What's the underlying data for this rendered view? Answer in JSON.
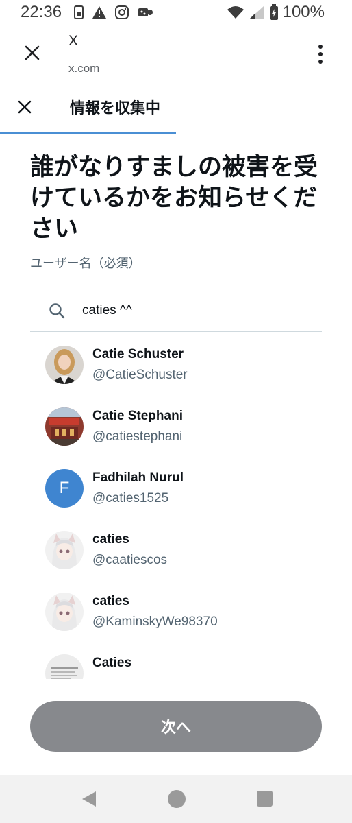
{
  "status_bar": {
    "time": "22:36",
    "battery": "100%",
    "icons": [
      "sim-icon",
      "warning-icon",
      "instagram-icon",
      "game-icon",
      "wifi-icon",
      "signal-icon",
      "battery-icon"
    ]
  },
  "browser": {
    "title": "X",
    "url": "x.com",
    "close_icon": "close-icon",
    "menu_icon": "more-vertical-icon"
  },
  "sheet": {
    "title": "情報を収集中",
    "progress_fraction": 0.5,
    "accent_color": "#4a8fd4"
  },
  "form": {
    "heading": "誰がなりすましの被害を受けているかをお知らせください",
    "field_label": "ユーザー名（必須）",
    "search_value": "caties ^^"
  },
  "results": [
    {
      "name": "Catie Schuster",
      "handle": "@CatieSchuster",
      "avatar": "photo"
    },
    {
      "name": "Catie Stephani",
      "handle": "@catiestephani",
      "avatar": "photo"
    },
    {
      "name": "Fadhilah Nurul",
      "handle": "@caties1525",
      "avatar": "letter",
      "letter": "F",
      "avatar_color": "#3f85d0"
    },
    {
      "name": "caties",
      "handle": "@caatiescos",
      "avatar": "anime"
    },
    {
      "name": "caties",
      "handle": "@KaminskyWe98370",
      "avatar": "anime"
    },
    {
      "name": "Caties",
      "handle": "",
      "avatar": "media"
    }
  ],
  "next_button": {
    "label": "次へ",
    "color": "#87898d"
  }
}
